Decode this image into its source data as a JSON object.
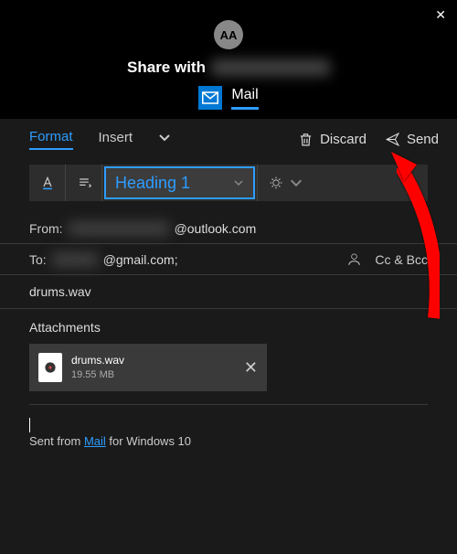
{
  "header": {
    "close_label": "✕",
    "avatar_initials": "AA",
    "share_prefix": "Share with",
    "share_target_placeholder": "redacted",
    "app_tab_label": "Mail"
  },
  "toolbar": {
    "tabs": {
      "format": "Format",
      "insert": "Insert"
    },
    "discard_label": "Discard",
    "send_label": "Send",
    "style_select_value": "Heading 1"
  },
  "fields": {
    "from_label": "From:",
    "from_domain": "@outlook.com",
    "to_label": "To:",
    "to_domain": "@gmail.com;",
    "cc_bcc_label": "Cc & Bcc"
  },
  "subject": "drums.wav",
  "attachments": {
    "label": "Attachments",
    "items": [
      {
        "name": "drums.wav",
        "size": "19.55 MB"
      }
    ]
  },
  "body_signature": {
    "prefix": "Sent from ",
    "link": "Mail",
    "suffix": " for Windows 10"
  }
}
